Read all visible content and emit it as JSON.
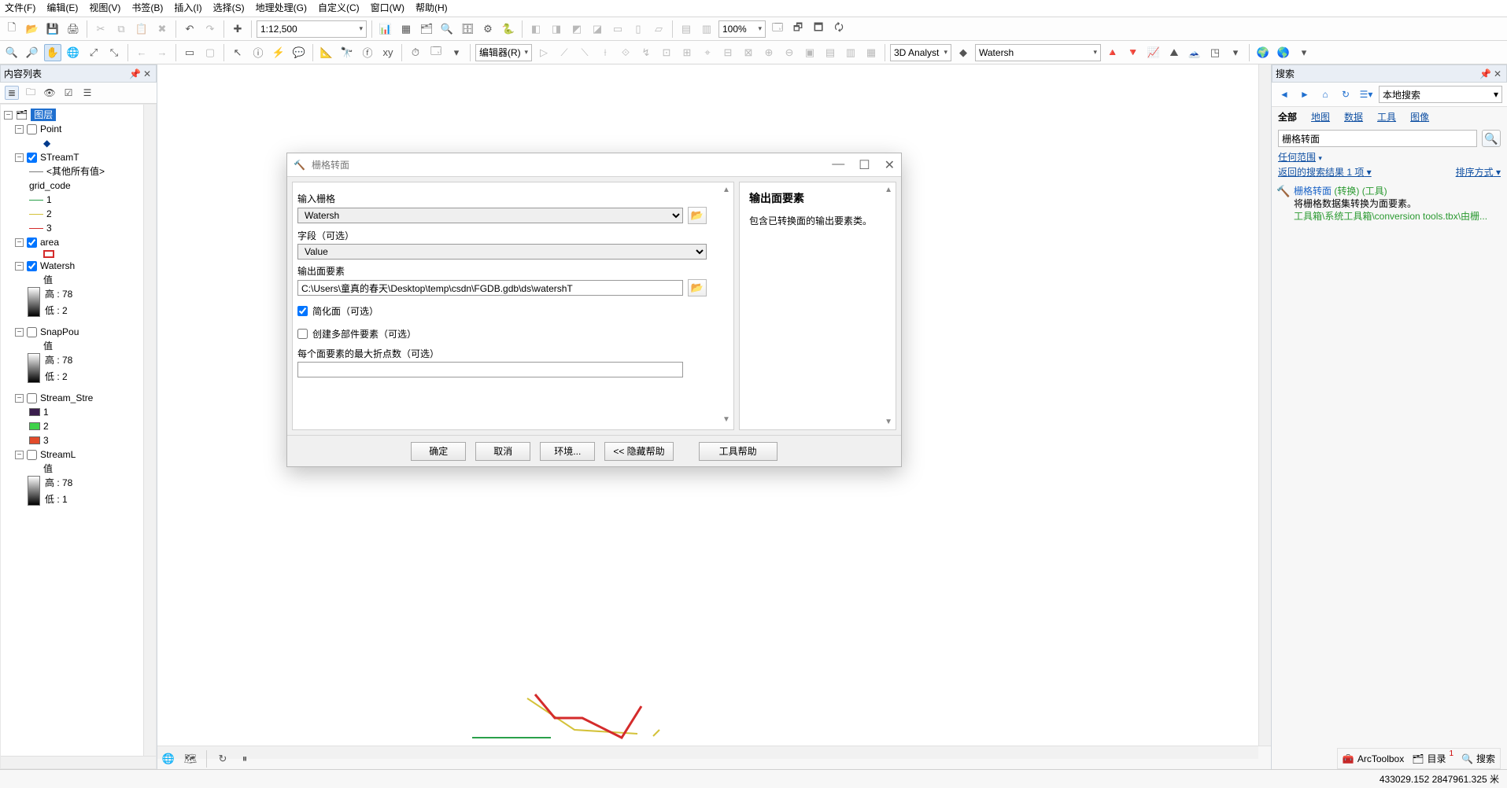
{
  "menu": [
    "文件(F)",
    "编辑(E)",
    "视图(V)",
    "书签(B)",
    "插入(I)",
    "选择(S)",
    "地理处理(G)",
    "自定义(C)",
    "窗口(W)",
    "帮助(H)"
  ],
  "scale": "1:12,500",
  "zoom_pct": "100%",
  "editor_label": "编辑器(R)",
  "analyst_label": "3D Analyst",
  "analyst_layer": "Watersh",
  "toc": {
    "title": "内容列表",
    "root": "图层",
    "layers": {
      "point": "Point",
      "streamt": "STreamT",
      "streamt_other": "<其他所有值>",
      "streamt_field": "grid_code",
      "streamt_vals": [
        "1",
        "2",
        "3"
      ],
      "area": "area",
      "watersh": "Watersh",
      "watersh_unit": "值",
      "watersh_high": "高 : 78",
      "watersh_low": "低 : 2",
      "snappou": "SnapPou",
      "snappou_unit": "值",
      "snappou_high": "高 : 78",
      "snappou_low": "低 : 2",
      "stream_stre": "Stream_Stre",
      "stream_stre_vals": [
        "1",
        "2",
        "3"
      ],
      "streaml": "StreamL",
      "streaml_unit": "值",
      "streaml_high": "高 : 78",
      "streaml_low": "低 : 1"
    }
  },
  "dialog": {
    "title": "栅格转面",
    "lbl_input": "输入栅格",
    "val_input": "Watersh",
    "lbl_field": "字段（可选）",
    "val_field": "Value",
    "lbl_output": "输出面要素",
    "val_output": "C:\\Users\\童真的春天\\Desktop\\temp\\csdn\\FGDB.gdb\\ds\\watershT",
    "chk_simplify": "简化面（可选）",
    "chk_multipart": "创建多部件要素（可选）",
    "lbl_maxvertex": "每个面要素的最大折点数（可选）",
    "val_maxvertex": "",
    "help_title": "输出面要素",
    "help_body": "包含已转换面的输出要素类。",
    "btn_ok": "确定",
    "btn_cancel": "取消",
    "btn_env": "环境...",
    "btn_hide": "<< 隐藏帮助",
    "btn_toolhelp": "工具帮助"
  },
  "search": {
    "title": "搜索",
    "source": "本地搜索",
    "cats": {
      "all": "全部",
      "map": "地图",
      "data": "数据",
      "tool": "工具",
      "img": "图像"
    },
    "query": "栅格转面",
    "scope": "任何范围",
    "result_count": "返回的搜索结果 1 项",
    "sort": "排序方式",
    "r1_title_a": "栅格转面",
    "r1_title_b": " (转换) ",
    "r1_title_c": "(工具)",
    "r1_desc": "将栅格数据集转换为面要素。",
    "r1_path": "工具箱\\系统工具箱\\conversion tools.tbx\\由栅..."
  },
  "bottom_tabs": {
    "arctoolbox": "ArcToolbox",
    "catalog": "目录",
    "search": "搜索",
    "badge": "1"
  },
  "status": {
    "coord": "433029.152 2847961.325 米"
  }
}
